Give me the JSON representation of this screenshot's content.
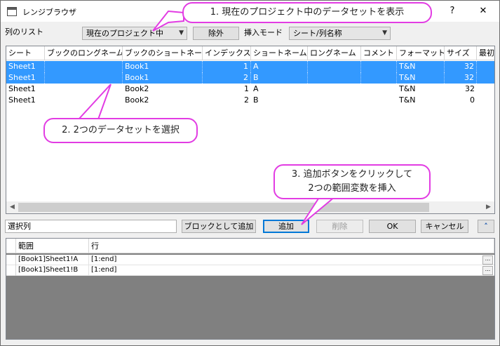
{
  "window": {
    "title": "レンジブラウザ",
    "help_label": "?",
    "close_label": "✕"
  },
  "toolbar": {
    "column_list_label": "列のリスト",
    "scope_value": "現在のプロジェクト中",
    "exclude_label": "除外",
    "insert_mode_label": "挿入モード",
    "insert_mode_value": "シート/列名称"
  },
  "table": {
    "headers": [
      "シート",
      "ブックのロングネーム",
      "ブックのショートネーム",
      "インデックス",
      "ショートネーム",
      "ロングネーム",
      "コメント",
      "フォーマット",
      "サイズ",
      "最初"
    ],
    "rows": [
      {
        "sheet": "Sheet1",
        "book_long": "",
        "book_short": "Book1",
        "index": "1",
        "short_name": "A",
        "long_name": "",
        "comment": "",
        "format": "T&N",
        "size": "32",
        "selected": true
      },
      {
        "sheet": "Sheet1",
        "book_long": "",
        "book_short": "Book1",
        "index": "2",
        "short_name": "B",
        "long_name": "",
        "comment": "",
        "format": "T&N",
        "size": "32",
        "selected": true
      },
      {
        "sheet": "Sheet1",
        "book_long": "",
        "book_short": "Book2",
        "index": "1",
        "short_name": "A",
        "long_name": "",
        "comment": "",
        "format": "T&N",
        "size": "32",
        "selected": false
      },
      {
        "sheet": "Sheet1",
        "book_long": "",
        "book_short": "Book2",
        "index": "2",
        "short_name": "B",
        "long_name": "",
        "comment": "",
        "format": "T&N",
        "size": "0",
        "selected": false
      }
    ]
  },
  "actions": {
    "selection_value": "選択列",
    "add_as_block": "ブロックとして追加",
    "add": "追加",
    "delete": "削除",
    "ok": "OK",
    "cancel": "キャンセル"
  },
  "ranges": {
    "headers": [
      "範囲",
      "行"
    ],
    "rows": [
      {
        "range": "[Book1]Sheet1!A",
        "rows": "[1:end]",
        "more": "..."
      },
      {
        "range": "[Book1]Sheet1!B",
        "rows": "[1:end]",
        "more": "..."
      }
    ]
  },
  "callouts": {
    "c1": "1. 現在のプロジェクト中のデータセットを表示",
    "c2": "2. 2つのデータセットを選択",
    "c3_line1": "3. 追加ボタンをクリックして",
    "c3_line2": "2つの範囲変数を挿入"
  },
  "colors": {
    "selection": "#3399ff",
    "callout_border": "#e23ce3",
    "focus_border": "#0078d7"
  }
}
